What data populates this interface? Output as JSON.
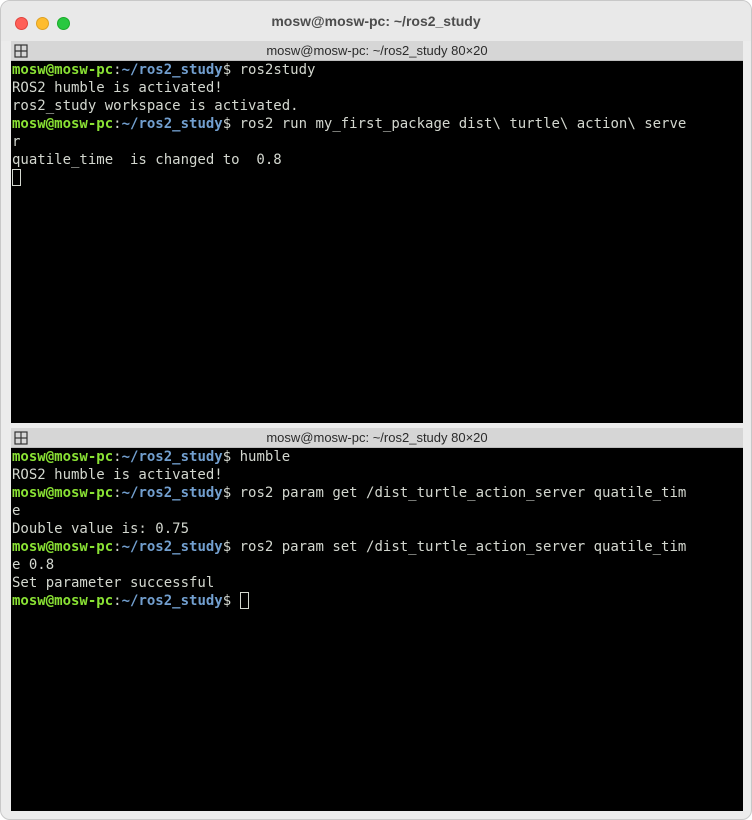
{
  "window": {
    "title": "mosw@mosw-pc: ~/ros2_study"
  },
  "colors": {
    "prompt_user": "#8ae234",
    "prompt_path": "#729fcf",
    "text": "#d3d7cf",
    "terminal_bg": "#000000"
  },
  "icons": {
    "pane_split": "split-pane-icon"
  },
  "pane_top": {
    "title": "mosw@mosw-pc: ~/ros2_study 80×20",
    "lines": [
      {
        "user": "mosw@mosw-pc",
        "sep": ":",
        "path": "~/ros2_study",
        "sym": "$ ",
        "cmd": "ros2study"
      },
      {
        "text": "ROS2 humble is activated!"
      },
      {
        "text": "ros2_study workspace is activated."
      },
      {
        "user": "mosw@mosw-pc",
        "sep": ":",
        "path": "~/ros2_study",
        "sym": "$ ",
        "cmd": "ros2 run my_first_package dist\\ turtle\\ action\\ serve"
      },
      {
        "text": "r"
      },
      {
        "text": "quatile_time  is changed to  0.8"
      }
    ]
  },
  "pane_bottom": {
    "title": "mosw@mosw-pc: ~/ros2_study 80×20",
    "lines": [
      {
        "user": "mosw@mosw-pc",
        "sep": ":",
        "path": "~/ros2_study",
        "sym": "$ ",
        "cmd": "humble"
      },
      {
        "text": "ROS2 humble is activated!"
      },
      {
        "user": "mosw@mosw-pc",
        "sep": ":",
        "path": "~/ros2_study",
        "sym": "$ ",
        "cmd": "ros2 param get /dist_turtle_action_server quatile_tim"
      },
      {
        "text": "e"
      },
      {
        "text": "Double value is: 0.75"
      },
      {
        "user": "mosw@mosw-pc",
        "sep": ":",
        "path": "~/ros2_study",
        "sym": "$ ",
        "cmd": "ros2 param set /dist_turtle_action_server quatile_tim"
      },
      {
        "text": "e 0.8"
      },
      {
        "text": "Set parameter successful"
      },
      {
        "user": "mosw@mosw-pc",
        "sep": ":",
        "path": "~/ros2_study",
        "sym": "$ ",
        "cmd": ""
      }
    ]
  }
}
